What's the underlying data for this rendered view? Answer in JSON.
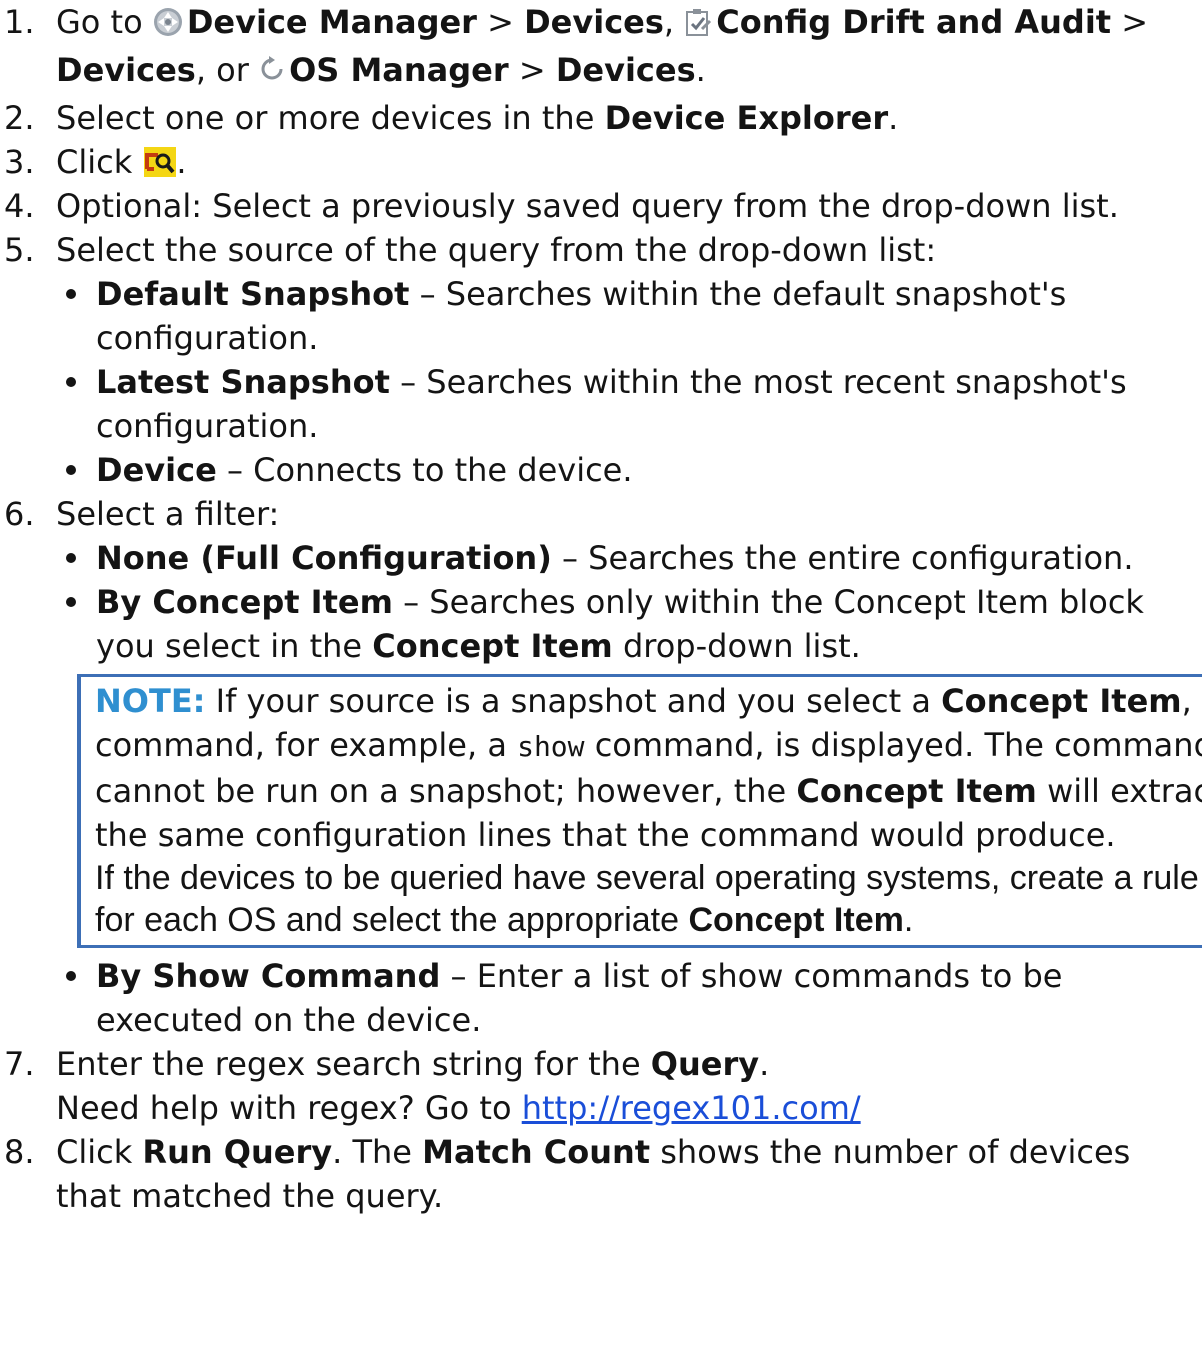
{
  "steps": [
    {
      "num": "1.",
      "parts": {
        "a": "Go to ",
        "b": "Device Manager",
        "c": " > ",
        "d": "Devices",
        "e": ", ",
        "f": "Config Drift and Audit",
        "g": " > ",
        "h": "Devices",
        "i": ", or ",
        "j": "OS Manager",
        "k": " > ",
        "l": "Devices",
        "m": "."
      },
      "icons": [
        "device-manager-icon",
        "config-drift-icon",
        "os-manager-icon"
      ]
    },
    {
      "num": "2.",
      "parts": {
        "a": "Select one or more devices in the ",
        "b": "Device Explorer",
        "c": "."
      }
    },
    {
      "num": "3.",
      "parts": {
        "a": "Click ",
        "b": "."
      },
      "icon": "query-search-icon"
    },
    {
      "num": "4.",
      "text": "Optional: Select a previously saved query from the drop-down list."
    },
    {
      "num": "5.",
      "text": "Select the source of the query from the drop-down list:",
      "bullets": [
        {
          "bold": "Default Snapshot",
          "rest": " – Searches within the default snapshot's configuration."
        },
        {
          "bold": "Latest Snapshot",
          "rest": " – Searches within the most recent snapshot's configuration."
        },
        {
          "bold": "Device",
          "rest": " – Connects to the device."
        }
      ]
    },
    {
      "num": "6.",
      "text": "Select a filter:",
      "bullets": [
        {
          "bold": "None (Full Configuration)",
          "rest": " – Searches the entire configuration."
        },
        {
          "bold": "By Concept Item",
          "rest": " – Searches only within the Concept Item block you select in the ",
          "bold2": "Concept Item",
          "rest2": " drop-down list."
        },
        {
          "bold": "By Show Command",
          "rest": " – Enter a list of show commands to be executed on the device."
        }
      ],
      "note": {
        "label": "NOTE:",
        "p1": " If your source is a snapshot and you select a ",
        "b1": "Concept Item",
        "p2": ", a command, for example, a ",
        "code": "show",
        "p3": " command, is displayed. The command cannot be run on a snapshot; however, the ",
        "b2": "Concept Item",
        "p4": " will extract the same configuration lines that the command would produce.",
        "s1": "If the devices to be queried have several operating systems, create a rule for each OS and select the appropriate ",
        "sb": "Concept Item",
        "s2": "."
      }
    },
    {
      "num": "7.",
      "parts": {
        "a": "Enter the regex search string for the ",
        "b": "Query",
        "c": "."
      },
      "help": "Need help with regex? Go to ",
      "link": "http://regex101.com/"
    },
    {
      "num": "8.",
      "parts": {
        "a": "Click ",
        "b": "Run Query",
        "c": ". The ",
        "d": "Match Count",
        "e": " shows the number of devices that matched the query."
      }
    }
  ],
  "colors": {
    "note_border": "#3d6fb6",
    "note_label": "#2f8fd0",
    "link": "#1a4ed8",
    "query_icon_bg": "#f4d614"
  }
}
